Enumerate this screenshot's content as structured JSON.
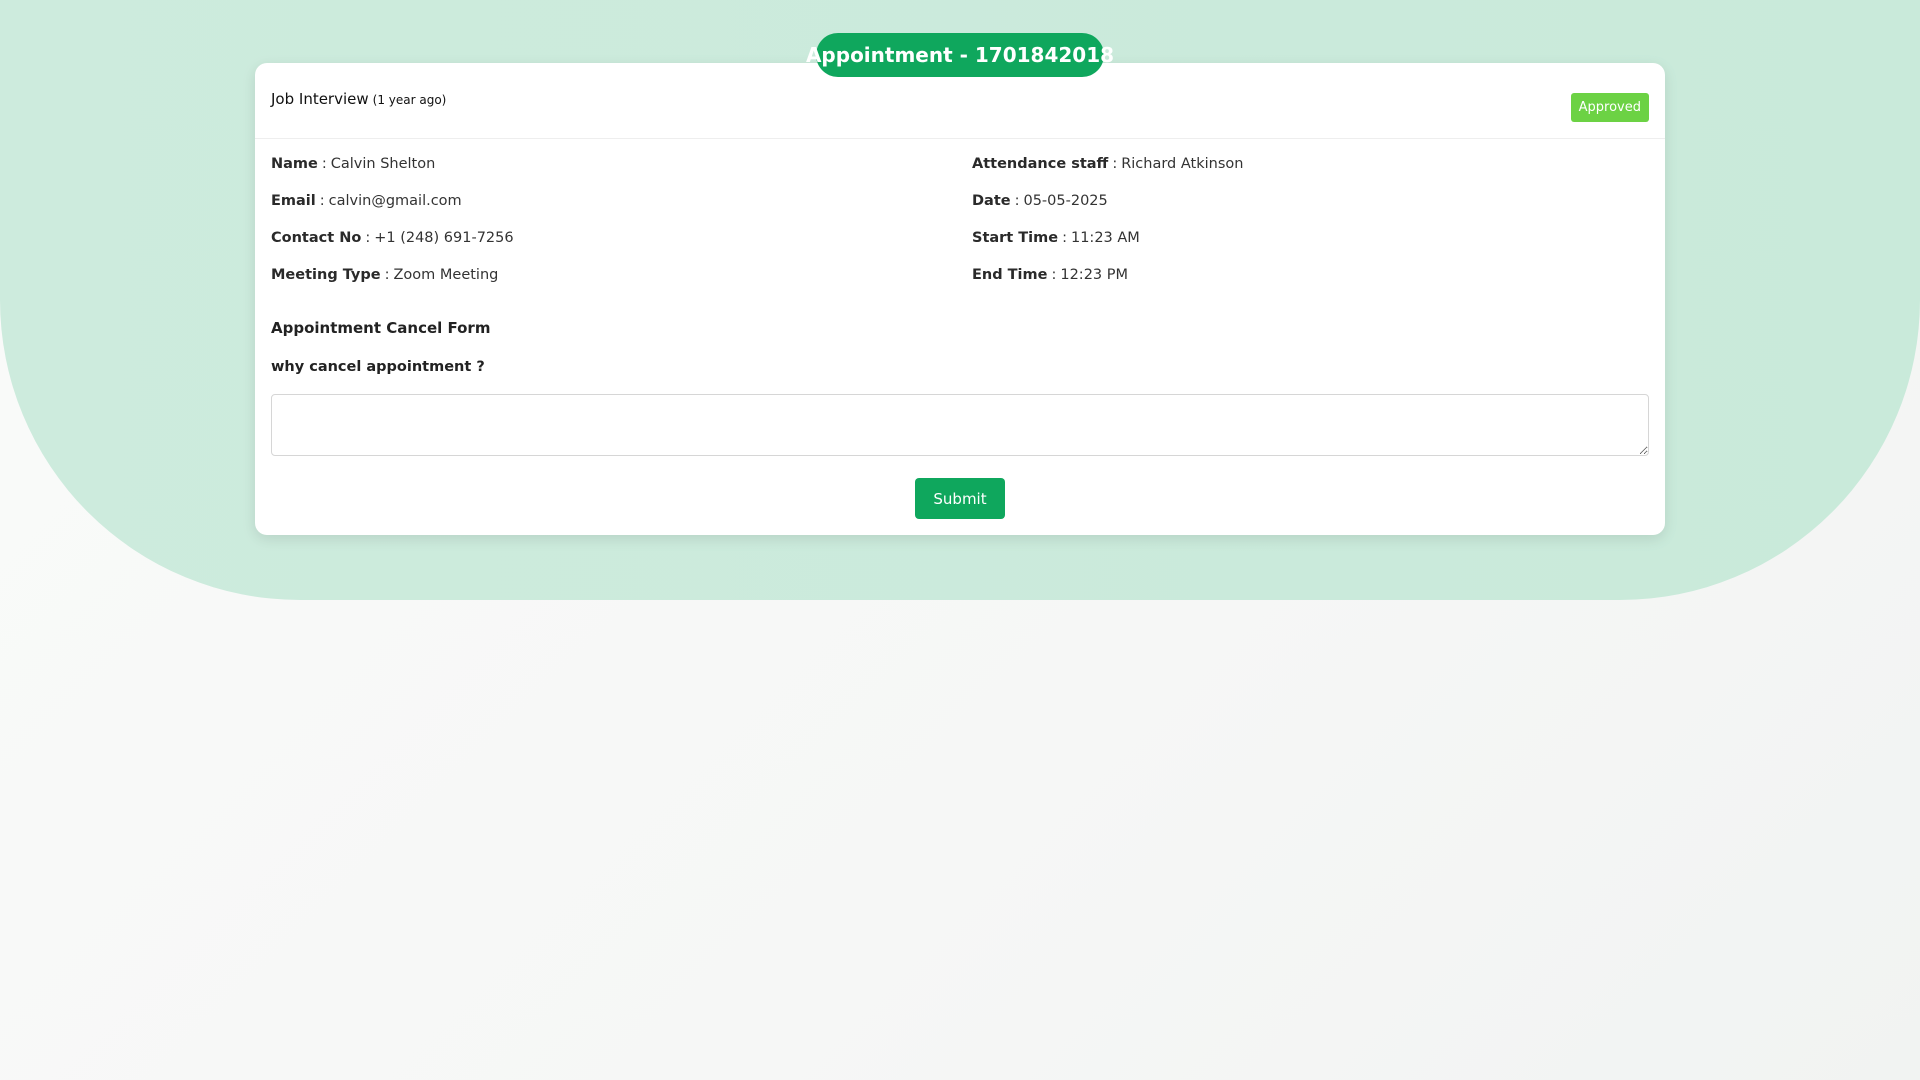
{
  "page": {
    "title_pill": "Appointment - 1701842018"
  },
  "card": {
    "header": {
      "title": "Job Interview",
      "time_ago": "(1 year ago)",
      "status": "Approved"
    },
    "left_fields": [
      {
        "label": "Name",
        "value": "Calvin Shelton"
      },
      {
        "label": "Email",
        "value": "calvin@gmail.com"
      },
      {
        "label": "Contact No",
        "value": "+1 (248) 691-7256"
      },
      {
        "label": "Meeting Type",
        "value": "Zoom Meeting"
      }
    ],
    "right_fields": [
      {
        "label": "Attendance staff",
        "value": "Richard Atkinson"
      },
      {
        "label": "Date",
        "value": "05-05-2025"
      },
      {
        "label": "Start Time",
        "value": "11:23 AM"
      },
      {
        "label": "End Time",
        "value": "12:23 PM"
      }
    ],
    "separator": ":",
    "cancel_form": {
      "title": "Appointment Cancel Form",
      "question": "why cancel appointment ?",
      "textarea_value": "",
      "submit_label": "Submit"
    }
  },
  "colors": {
    "accent": "#0fa75d",
    "status_approved": "#6cd244",
    "background_band": "#cdebdd"
  }
}
